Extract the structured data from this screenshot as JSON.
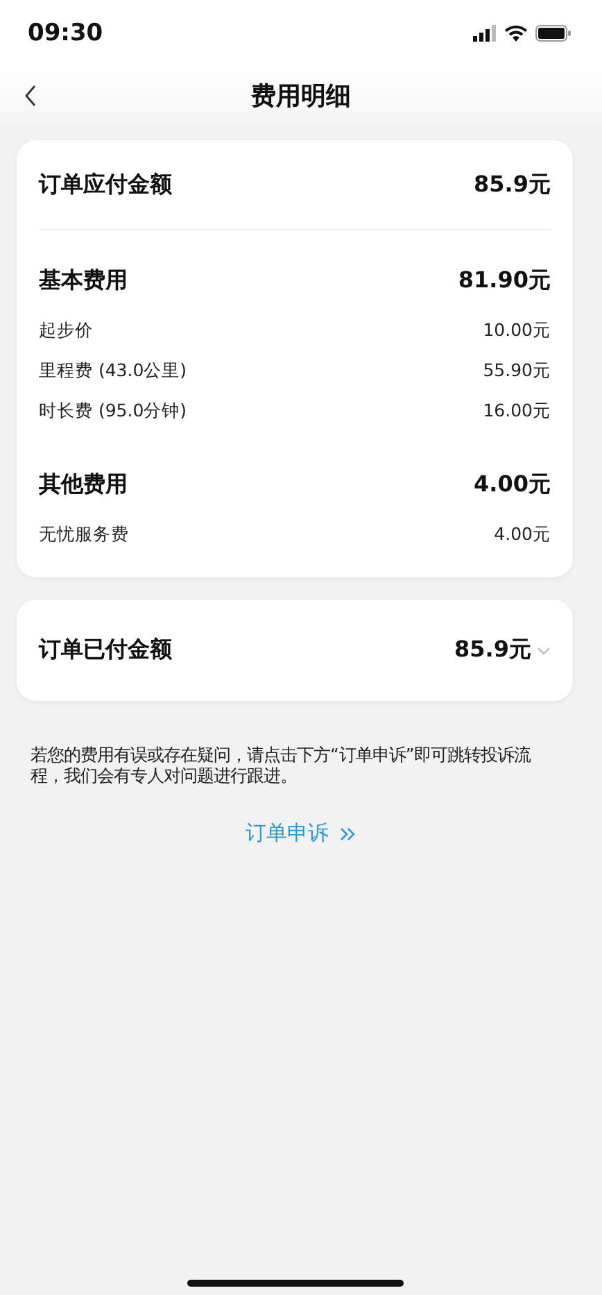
{
  "status_bar": {
    "time": "09:30"
  },
  "nav": {
    "title": "费用明细"
  },
  "payable": {
    "label": "订单应付金额",
    "amount": "85.9元"
  },
  "groups": [
    {
      "title": "基本费用",
      "amount": "81.90元",
      "items": [
        {
          "label": "起步价",
          "amount": "10.00元"
        },
        {
          "label": "里程费 (43.0公里)",
          "amount": "55.90元"
        },
        {
          "label": "时长费 (95.0分钟)",
          "amount": "16.00元"
        }
      ]
    },
    {
      "title": "其他费用",
      "amount": "4.00元",
      "items": [
        {
          "label": "无忧服务费",
          "amount": "4.00元"
        }
      ]
    }
  ],
  "paid": {
    "label": "订单已付金额",
    "amount": "85.9元",
    "expanded": false
  },
  "note": "若您的费用有误或存在疑问，请点击下方“订单申诉”即可跳转投诉流程，我们会有专人对问题进行跟进。",
  "appeal_link": "订单申诉"
}
